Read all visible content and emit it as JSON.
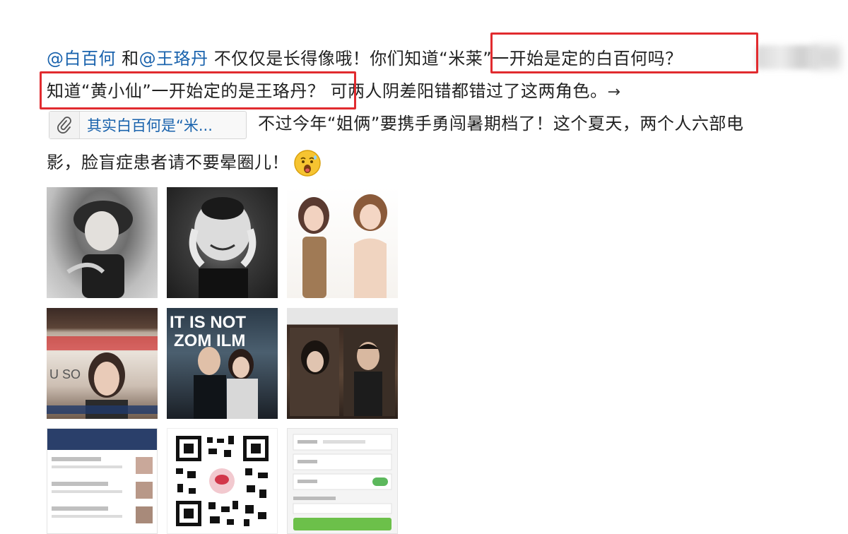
{
  "post": {
    "line1": {
      "mention1": "@白百何",
      "and": " 和",
      "mention2": "@王珞丹",
      "text": " 不仅仅是长得像哦！你们知道",
      "highlight": "“米莱”一开始是定的白百何吗？"
    },
    "line2": {
      "highlight": "知道“黄小仙”一开始定的是王珞丹？",
      "text": " 可两人阴差阳错都错过了这两角色。",
      "arrow": "→"
    },
    "link_card": {
      "icon": "paperclip-icon",
      "label": "其实白百何是“米..."
    },
    "line3": "不过今年“姐俩”要携手勇闯暑期档了！这个夏天，两个人六部电",
    "line4": "影，脸盲症患者请不要晕圈儿！",
    "emoji": "shocked-emoji-icon"
  },
  "colors": {
    "mention": "#1a63ad",
    "highlight_border": "#e12b2f"
  },
  "images": [
    "portrait-photo",
    "portrait-photo",
    "portrait-photo",
    "portrait-photo",
    "movie-poster",
    "movie-poster",
    "screenshot",
    "qr-code",
    "screenshot"
  ]
}
